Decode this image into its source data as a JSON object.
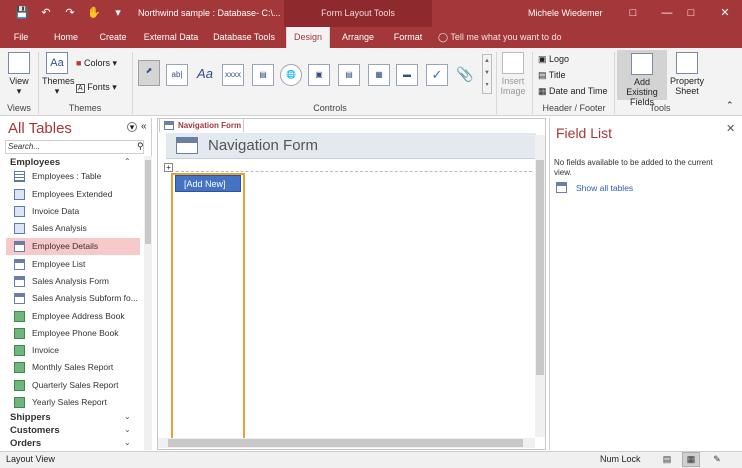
{
  "titlebar": {
    "doc_title": "Northwind sample : Database- C:\\...",
    "context_tab": "Form Layout Tools",
    "user": "Michele Wiedemer",
    "qat": [
      "save-icon",
      "undo-icon",
      "redo-icon",
      "touch-mode-icon",
      "customize-qat-icon"
    ]
  },
  "ribbon_tabs": [
    "File",
    "Home",
    "Create",
    "External Data",
    "Database Tools",
    "Design",
    "Arrange",
    "Format"
  ],
  "active_tab": "Design",
  "tell_me": "Tell me what you want to do",
  "ribbon": {
    "views": {
      "label": "Views",
      "view_btn": "View"
    },
    "themes": {
      "label": "Themes",
      "themes_btn": "Themes",
      "colors_btn": "Colors",
      "fonts_btn": "Fonts"
    },
    "controls": {
      "label": "Controls"
    },
    "insert_image": "Insert Image",
    "header_footer": {
      "label": "Header / Footer",
      "logo": "Logo",
      "title": "Title",
      "datetime": "Date and Time"
    },
    "tools": {
      "label": "Tools",
      "add_fields": "Add Existing Fields",
      "property_sheet": "Property Sheet"
    }
  },
  "nav": {
    "title": "All Tables",
    "search_placeholder": "Search...",
    "categories": [
      {
        "name": "Employees",
        "expanded": true
      },
      {
        "name": "Shippers",
        "expanded": false
      },
      {
        "name": "Customers",
        "expanded": false
      },
      {
        "name": "Orders",
        "expanded": false
      }
    ],
    "items": [
      {
        "label": "Employees : Table",
        "type": "table"
      },
      {
        "label": "Employees Extended",
        "type": "query"
      },
      {
        "label": "Invoice Data",
        "type": "query"
      },
      {
        "label": "Sales Analysis",
        "type": "query"
      },
      {
        "label": "Employee Details",
        "type": "form",
        "selected": true
      },
      {
        "label": "Employee List",
        "type": "form"
      },
      {
        "label": "Sales Analysis Form",
        "type": "form"
      },
      {
        "label": "Sales Analysis Subform fo...",
        "type": "form"
      },
      {
        "label": "Employee Address Book",
        "type": "report"
      },
      {
        "label": "Employee Phone Book",
        "type": "report"
      },
      {
        "label": "Invoice",
        "type": "report"
      },
      {
        "label": "Monthly Sales Report",
        "type": "report"
      },
      {
        "label": "Quarterly Sales Report",
        "type": "report"
      },
      {
        "label": "Yearly Sales Report",
        "type": "report"
      }
    ]
  },
  "document": {
    "tab_label": "Navigation Form",
    "form_title": "Navigation Form",
    "add_new": "[Add New]"
  },
  "field_list": {
    "title": "Field List",
    "message": "No fields available to be added to the current view.",
    "show_all": "Show all tables"
  },
  "statusbar": {
    "left": "Layout View",
    "numlock": "Num Lock"
  },
  "colors": {
    "accent": "#a4373a",
    "selected_nav": "#f8c9cb",
    "add_new": "#4472c4"
  }
}
